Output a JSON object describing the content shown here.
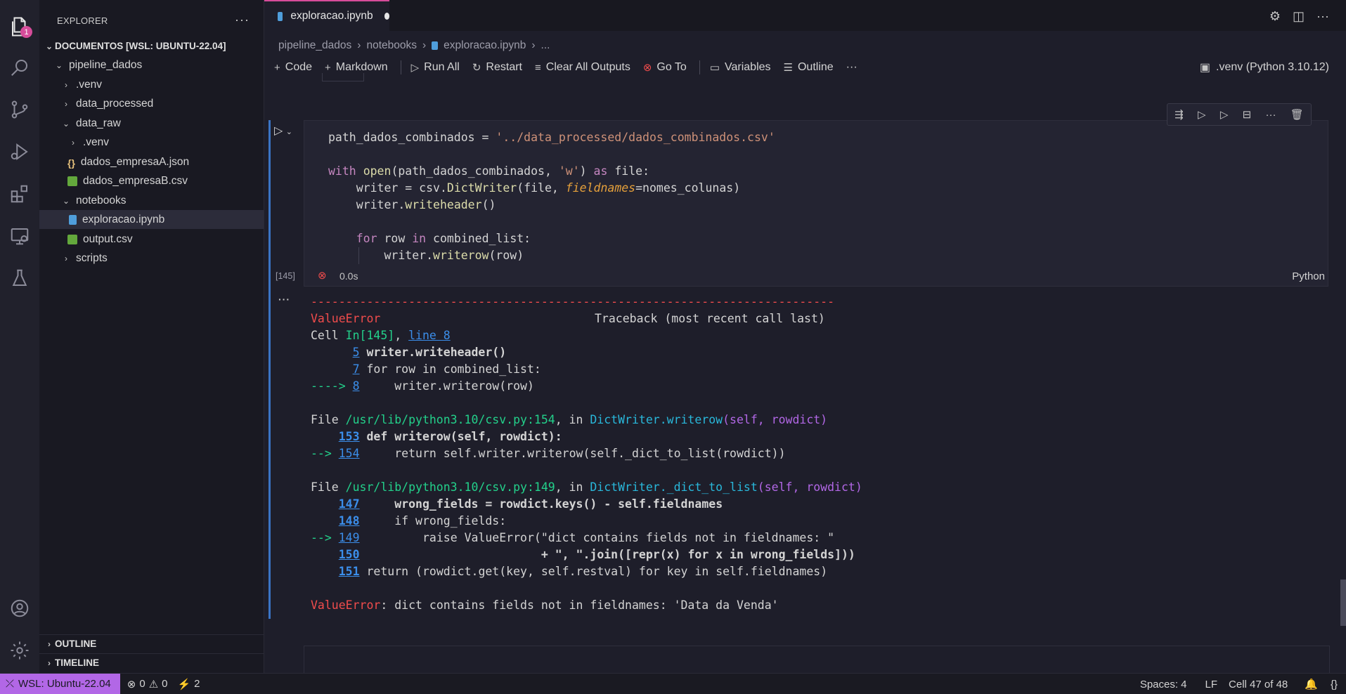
{
  "activity": {
    "badge": "1"
  },
  "sidebar": {
    "title": "EXPLORER",
    "more": "···",
    "workspace": "DOCUMENTOS [WSL: UBUNTU-22.04]",
    "tree": [
      {
        "label": "pipeline_dados",
        "chev": "⌄"
      },
      {
        "label": ".venv",
        "chev": "›"
      },
      {
        "label": "data_processed",
        "chev": "›"
      },
      {
        "label": "data_raw",
        "chev": "⌄"
      },
      {
        "label": ".venv",
        "chev": "›"
      },
      {
        "label": "dados_empresaA.json",
        "icon": "{}"
      },
      {
        "label": "dados_empresaB.csv"
      },
      {
        "label": "notebooks",
        "chev": "⌄"
      },
      {
        "label": "exploracao.ipynb"
      },
      {
        "label": "output.csv"
      },
      {
        "label": "scripts",
        "chev": "›"
      }
    ],
    "outline": "OUTLINE",
    "timeline": "TIMELINE"
  },
  "tab": {
    "label": "exploracao.ipynb"
  },
  "breadcrumb": [
    "pipeline_dados",
    "notebooks",
    "exploracao.ipynb",
    "..."
  ],
  "toolbar": {
    "code": "Code",
    "markdown": "Markdown",
    "run_all": "Run All",
    "restart": "Restart",
    "clear": "Clear All Outputs",
    "goto": "Go To",
    "variables": "Variables",
    "outline": "Outline",
    "more": "···",
    "kernel": ".venv (Python 3.10.12)"
  },
  "cell": {
    "exec_count": "[145]",
    "duration": "0.0s",
    "language": "Python",
    "code": [
      "path_dados_combinados = '../data_processed/dados_combinados.csv'",
      "",
      "with open(path_dados_combinados, 'w') as file:",
      "    writer = csv.DictWriter(file, fieldnames=nomes_colunas)",
      "    writer.writeheader()",
      "",
      "    for row in combined_list:",
      "        writer.writerow(row)"
    ]
  },
  "output": {
    "more": "···",
    "dashes": "---------------------------------------------------------------------------",
    "error_name": "ValueError",
    "traceback_header": "Traceback (most recent call last)",
    "cell_prefix": "Cell ",
    "cell_in": "In[145]",
    "cell_sep": ", ",
    "cell_line": "line 8",
    "frame1": [
      {
        "arrow": "      ",
        "num": "5",
        "text": "writer.writeheader()"
      },
      {
        "arrow": "      ",
        "num": "7",
        "text": "for row in combined_list:"
      },
      {
        "arrow": "----> ",
        "num": "8",
        "text": "    writer.writerow(row)"
      }
    ],
    "file1_prefix": "File ",
    "file1_path": "/usr/lib/python3.10/csv.py:154",
    "file1_in": ", in ",
    "file1_func": "DictWriter.writerow",
    "file1_args": "(self, rowdict)",
    "frame2": [
      {
        "arrow": "    ",
        "num": "153",
        "text": "def writerow(self, rowdict):"
      },
      {
        "arrow": "--> ",
        "num": "154",
        "text": "    return self.writer.writerow(self._dict_to_list(rowdict))"
      }
    ],
    "file2_prefix": "File ",
    "file2_path": "/usr/lib/python3.10/csv.py:149",
    "file2_in": ", in ",
    "file2_func": "DictWriter._dict_to_list",
    "file2_args": "(self, rowdict)",
    "frame3": [
      {
        "arrow": "    ",
        "num": "147",
        "text": "    wrong_fields = rowdict.keys() - self.fieldnames"
      },
      {
        "arrow": "    ",
        "num": "148",
        "text": "    if wrong_fields:"
      },
      {
        "arrow": "--> ",
        "num": "149",
        "text": "        raise ValueError(\"dict contains fields not in fieldnames: \""
      },
      {
        "arrow": "    ",
        "num": "150",
        "text": "                         + \", \".join([repr(x) for x in wrong_fields]))"
      },
      {
        "arrow": "    ",
        "num": "151",
        "text": "return (rowdict.get(key, self.restval) for key in self.fieldnames)"
      }
    ],
    "final_error": "ValueError",
    "final_message": ": dict contains fields not in fieldnames: 'Data da Venda'"
  },
  "statusbar": {
    "remote": "WSL: Ubuntu-22.04",
    "errors": "0",
    "warnings": "0",
    "ports": "2",
    "spaces": "Spaces: 4",
    "eol": "LF",
    "cell_pos": "Cell 47 of 48"
  },
  "colors": {
    "accent": "#d64c9a",
    "remote": "#b267e6",
    "error": "#f14c4c",
    "link": "#3b8eea"
  }
}
